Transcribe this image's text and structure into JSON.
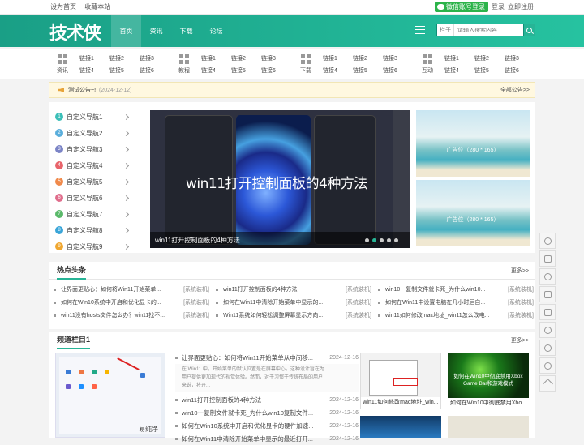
{
  "topbar": {
    "set_home": "设为首页",
    "bookmark": "收藏本站",
    "wechat_login": "微信账号登录",
    "login": "登录",
    "register": "立即注册"
  },
  "logo": "技术侠",
  "nav": [
    "首页",
    "资讯",
    "下载",
    "论坛"
  ],
  "search": {
    "category": "栏子",
    "placeholder": "请输入搜索内容"
  },
  "categories": [
    {
      "name": "资讯",
      "links": [
        "链接1",
        "链接2",
        "链接3",
        "链接4",
        "链接5",
        "链接6"
      ]
    },
    {
      "name": "教程",
      "links": [
        "链接1",
        "链接2",
        "链接3",
        "链接4",
        "链接5",
        "链接6"
      ]
    },
    {
      "name": "下载",
      "links": [
        "链接1",
        "链接2",
        "链接3",
        "链接4",
        "链接5",
        "链接6"
      ]
    },
    {
      "name": "互动",
      "links": [
        "链接1",
        "链接2",
        "链接3",
        "链接4",
        "链接5",
        "链接6"
      ]
    }
  ],
  "notice": {
    "text": "测试公告~!",
    "date": "(2024-12-12)",
    "all": "全部公告>>"
  },
  "side_nav": [
    {
      "n": "1",
      "label": "自定义导航1",
      "color": "#3cbfb8"
    },
    {
      "n": "2",
      "label": "自定义导航2",
      "color": "#5aaedc"
    },
    {
      "n": "3",
      "label": "自定义导航3",
      "color": "#7b84c6"
    },
    {
      "n": "4",
      "label": "自定义导航4",
      "color": "#e8646b"
    },
    {
      "n": "5",
      "label": "自定义导航5",
      "color": "#f08a4b"
    },
    {
      "n": "6",
      "label": "自定义导航6",
      "color": "#e06d8c"
    },
    {
      "n": "7",
      "label": "自定义导航7",
      "color": "#5ab96a"
    },
    {
      "n": "8",
      "label": "自定义导航8",
      "color": "#3aa5d8"
    },
    {
      "n": "9",
      "label": "自定义导航9",
      "color": "#f0a730"
    }
  ],
  "slider": {
    "title": "win11打开控制面板的4种方法",
    "caption": "win11打开控制面板的4种方法",
    "active_dot": 2
  },
  "ads": [
    "广告位（280 * 165）",
    "广告位（280 * 165）"
  ],
  "hot": {
    "title": "热点头条",
    "more": "更多>>",
    "items": [
      {
        "t": "让界面更贴心：如何将Win11开始菜单...",
        "tag": "[系统装机]"
      },
      {
        "t": "win11打开控制面板的4种方法",
        "tag": "[系统装机]"
      },
      {
        "t": "win10一复制文件就卡死_为什么win10...",
        "tag": "[系统装机]"
      },
      {
        "t": "如何在Win10系统中开启和优化显卡的...",
        "tag": "[系统装机]"
      },
      {
        "t": "如何在Win11中清除开始菜单中显示的...",
        "tag": "[系统装机]"
      },
      {
        "t": "如何在Win11中设置电脑在几小时后自...",
        "tag": "[系统装机]"
      },
      {
        "t": "win11没有hosts文件怎么办？win11找不...",
        "tag": "[系统装机]"
      },
      {
        "t": "Win11系统如何轻松调整屏幕显示方向...",
        "tag": "[系统装机]"
      },
      {
        "t": "win11如何修改mac地址_win11怎么改电...",
        "tag": "[系统装机]"
      }
    ]
  },
  "channel": {
    "title": "频道栏目1",
    "more": "更多>>",
    "items": [
      {
        "t": "让界面更贴心：如何将Win11开始菜单从中间移...",
        "d": "2024-12-16",
        "summary": "在 Win11 中，开始菜单的默认位置是在屏幕中心，这种设计旨在为用户提供更加现代的视觉体验。然而，对于习惯于传统布局的用户来说，将开..."
      },
      {
        "t": "win11打开控制面板的4种方法",
        "d": "2024-12-16"
      },
      {
        "t": "win10一复制文件就卡死_为什么win10复制文件...",
        "d": "2024-12-16"
      },
      {
        "t": "如何在Win10系统中开启和优化显卡的硬件加速...",
        "d": "2024-12-16"
      },
      {
        "t": "如何在Win11中清除开始菜单中显示的最近打开...",
        "d": "2024-12-16"
      }
    ],
    "thumbs": [
      {
        "cap": "win11如何修改mac地址_win..."
      },
      {
        "cap": "如何在Win10中彻底禁用Xbo...",
        "overlay": "如何在Win10中彻底禁用Xbox Game Bar和游戏模式"
      }
    ],
    "shot_label": "易纯净"
  }
}
